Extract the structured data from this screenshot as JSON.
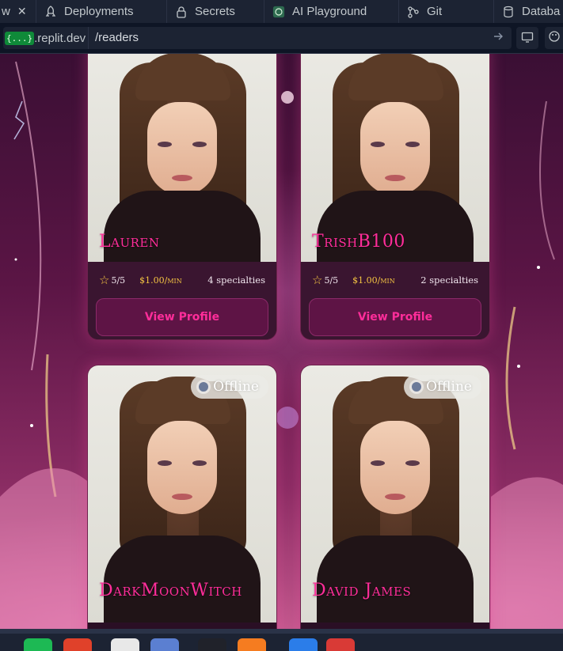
{
  "browser": {
    "tabs": [
      {
        "label": "w",
        "icon": "close-icon",
        "close": "✕"
      },
      {
        "label": "Deployments",
        "icon": "deploy-icon"
      },
      {
        "label": "Secrets",
        "icon": "lock-icon"
      },
      {
        "label": "AI Playground",
        "icon": "openai-icon"
      },
      {
        "label": "Git",
        "icon": "git-icon"
      },
      {
        "label": "Databa",
        "icon": "database-icon"
      }
    ],
    "address": {
      "domain_badge": "{...}",
      "domain": ".replit.dev",
      "path": "/readers"
    }
  },
  "readers": [
    {
      "name": "Lauren",
      "rating": "5/5",
      "price": "$1.00/min",
      "specialties": "4 specialties",
      "button": "View Profile"
    },
    {
      "name": "TrishB100",
      "rating": "5/5",
      "price": "$1.00/min",
      "specialties": "2 specialties",
      "button": "View Profile"
    },
    {
      "name": "DarkMoonWitch",
      "status": "Offline"
    },
    {
      "name": "David James",
      "status": "Offline"
    }
  ],
  "colors": {
    "accent": "#ff2d9a",
    "price": "#f5c542",
    "card_bg": "#3a1530",
    "button_bg": "#5e1445"
  }
}
